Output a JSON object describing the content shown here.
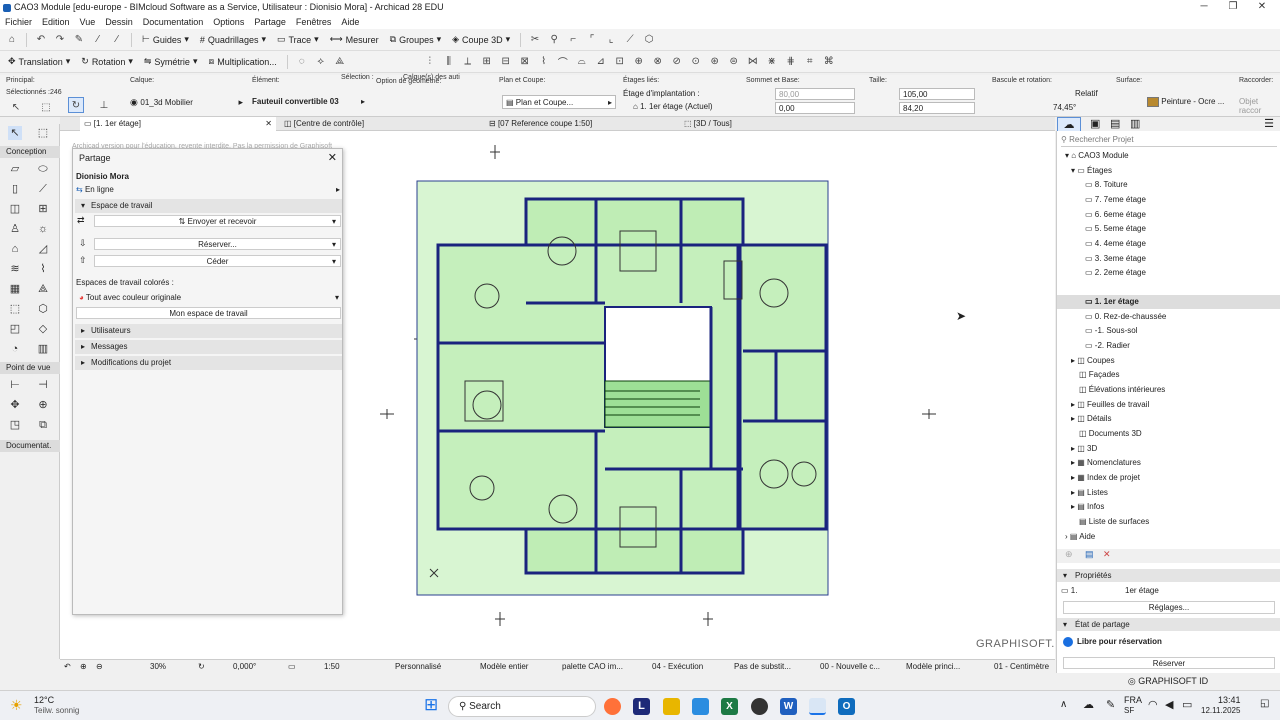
{
  "window": {
    "title": "CAO3 Module [edu-europe - BIMcloud Software as a Service, Utilisateur : Dionisio Mora] - Archicad 28 EDU",
    "min": "─",
    "max": "❐",
    "close": "✕"
  },
  "menu": [
    "Fichier",
    "Edition",
    "Vue",
    "Dessin",
    "Documentation",
    "Options",
    "Partage",
    "Fenêtres",
    "Aide"
  ],
  "toolbar1": {
    "guides": "Guides",
    "quadrillages": "Quadrillages",
    "trace": "Trace",
    "mesurer": "Mesurer",
    "groupes": "Groupes",
    "coupe3d": "Coupe 3D"
  },
  "toolbar2": {
    "translation": "Translation",
    "rotation": "Rotation",
    "symetrie": "Symétrie",
    "multiplication": "Multiplication..."
  },
  "infobox": {
    "principal_label": "Principal:",
    "selected_label": "Sélectionnés :246",
    "calque_label": "Calque:",
    "calque_value": "01_3d Mobilier",
    "element_label": "Élément:",
    "element_value": "Fauteuil convertible 03",
    "selection_label": "Sélection :",
    "calques_label": "Calque(s) des auti",
    "option_label": "Option de géométrie:",
    "plan_label": "Plan et Coupe:",
    "plan_value": "Plan et Coupe...",
    "etages_label": "Étages liés:",
    "etage_impl_label": "Étage d'implantation :",
    "etage_value": "1. 1er étage (Actuel)",
    "sommet_label": "Sommet et Base:",
    "sommet_top": "80,00",
    "sommet_base": "0,00",
    "taille_label": "Taille:",
    "taille_w": "105,00",
    "taille_h": "84,20",
    "bascule_label": "Bascule et rotation:",
    "relatif": "Relatif",
    "angle": "74,45°",
    "surface_label": "Surface:",
    "surface_value": "Peinture - Ocre ...",
    "raccorder_label": "Raccorder:",
    "objet_label": "Objet raccor",
    "surface_color": "#b8892f"
  },
  "tabs": [
    "[1. 1er étage]",
    "[Centre de contrôle]",
    "[07 Reference coupe 1:50]",
    "[3D / Tous]"
  ],
  "toolbox": {
    "conception": "Conception",
    "point_de_vue": "Point de vue",
    "documentation": "Documentat."
  },
  "teamwork": {
    "title": "Partage",
    "user": "Dionisio Mora",
    "status": "En ligne",
    "workspace_section": "Espace de travail",
    "send_receive": "Envoyer et recevoir",
    "reserve": "Réserver...",
    "release": "Céder",
    "colored_label": "Espaces de travail colorés :",
    "colored_value": "Tout avec couleur originale",
    "my_workspace": "Mon espace de travail",
    "users": "Utilisateurs",
    "messages": "Messages",
    "changes": "Modifications du projet",
    "watermark": "Archicad version pour l'éducation, revente interdite. Pas la permission de Graphisoft"
  },
  "navigator": {
    "search_placeholder": "Rechercher Projet",
    "project": "CAO3 Module",
    "storeys_folder": "Étages",
    "storeys": [
      "8. Toiture",
      "7. 7eme étage",
      "6. 6eme étage",
      "5. 5eme étage",
      "4. 4eme étage",
      "3. 3eme étage",
      "2. 2eme étage",
      "1. 1er étage",
      "0. Rez-de-chaussée",
      "-1. Sous-sol",
      "-2. Radier"
    ],
    "selected_storey": "1. 1er étage",
    "others": [
      "Coupes",
      "Façades",
      "Élévations intérieures",
      "Feuilles de travail",
      "Détails",
      "Documents 3D",
      "3D",
      "Nomenclatures",
      "Index de projet",
      "Listes",
      "Infos",
      "Liste de surfaces",
      "Aide"
    ],
    "props_title": "Propriétés",
    "props_num": "1.",
    "props_name": "1er étage",
    "settings": "Réglages...",
    "sharing_title": "État de partage",
    "sharing_status": "Libre pour réservation",
    "reserve_btn": "Réserver",
    "graphisoft_id": "GRAPHISOFT ID"
  },
  "canvas": {
    "logo": "GRAPHISOFT."
  },
  "bottombar": {
    "zoom": "30%",
    "angle": "0,000°",
    "scale": "1:50",
    "perso": "Personnalisé",
    "model": "Modèle entier",
    "palette": "palette CAO im...",
    "phase": "04 - Exécution",
    "subst": "Pas de substit...",
    "renov": "00 - Nouvelle c...",
    "model_view": "Modèle princi...",
    "units": "01 - Centimètre"
  },
  "taskbar": {
    "temp": "12°C",
    "weather": "Teilw. sonnig",
    "search": "Search",
    "lang": "FRA",
    "region": "SF",
    "time": "13:41",
    "date": "12.11.2025"
  }
}
